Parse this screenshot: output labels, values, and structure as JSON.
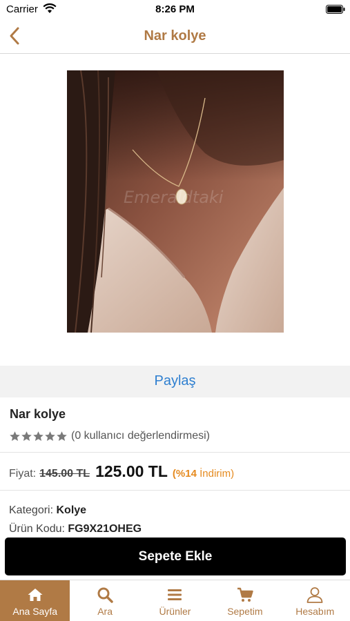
{
  "status_bar": {
    "carrier": "Carrier",
    "time": "8:26 PM"
  },
  "navbar": {
    "title": "Nar kolye",
    "back_icon": "chevron-left-icon"
  },
  "product": {
    "image_watermark": "Emeraldtaki",
    "share_label": "Paylaş",
    "name": "Nar kolye",
    "rating_stars": 0,
    "rating_text": "(0 kullanıcı değerlendirmesi)",
    "price_label": "Fiyat:",
    "old_price": "145.00 TL",
    "new_price": "125.00 TL",
    "discount_percent": "(%14",
    "discount_word": "İndirim)",
    "category_label": "Kategori:",
    "category_value": "Kolye",
    "code_label": "Ürün Kodu:",
    "code_value": "FG9X21OHEG",
    "add_to_cart": "Sepete Ekle"
  },
  "tabbar": {
    "items": [
      {
        "label": "Ana Sayfa",
        "icon": "home-icon",
        "active": true
      },
      {
        "label": "Ara",
        "icon": "search-icon",
        "active": false
      },
      {
        "label": "Ürünler",
        "icon": "menu-icon",
        "active": false
      },
      {
        "label": "Sepetim",
        "icon": "cart-icon",
        "active": false
      },
      {
        "label": "Hesabım",
        "icon": "user-icon",
        "active": false
      }
    ]
  },
  "colors": {
    "accent": "#b07a45",
    "link": "#2e7fd0",
    "discount": "#e58a1f"
  }
}
